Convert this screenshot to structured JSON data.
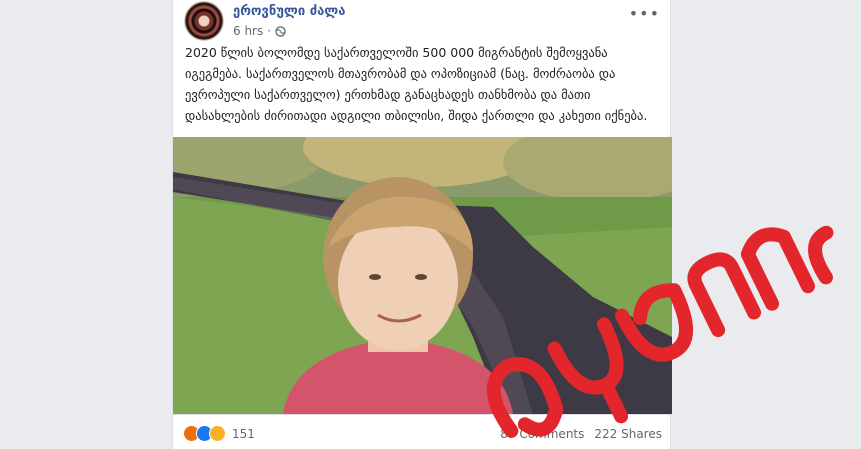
{
  "post": {
    "author": "ეროვნული ძალა",
    "time": "6 hrs",
    "privacy_icon": "globe-icon",
    "more_icon": "ellipsis-icon",
    "text": "2020 წლის ბოლომდე საქართველოში 500 000 მიგრანტის შემოყვანა იგეგმება. საქართველოს მთავრობამ და ოპოზიციამ (ნაც. მოძრაობა და ევროპული საქართველო) ერთხმად განაცხადეს თანხმობა და მათი დასახლების ძირითადი ადგილი თბილისი, შიდა ქართლი და კახეთი იქნება."
  },
  "image": {
    "stamp_text": "ტყუილია",
    "stamp_color": "#e3262b"
  },
  "footer": {
    "reaction_icons": [
      "angry-reaction-icon",
      "like-reaction-icon",
      "sad-reaction-icon"
    ],
    "reaction_count": "151",
    "comments": "89 Comments",
    "shares": "222 Shares"
  }
}
